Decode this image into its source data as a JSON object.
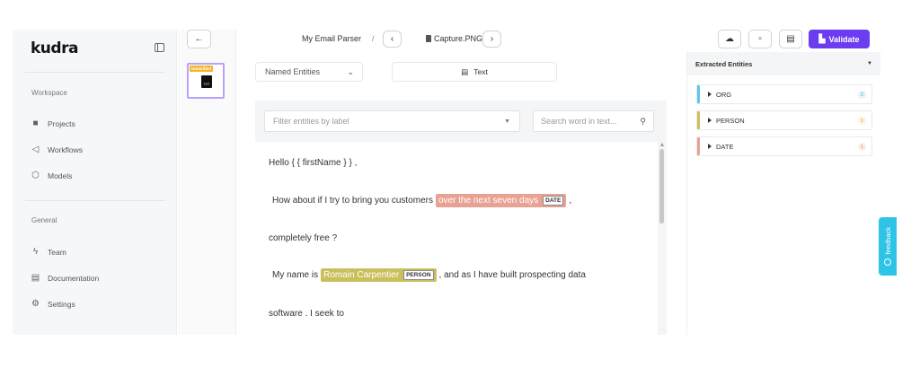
{
  "sidebar": {
    "logo": "kudra",
    "workspace_label": "Workspace",
    "workspace_items": [
      {
        "label": "Projects",
        "icon": "folder-icon"
      },
      {
        "label": "Workflows",
        "icon": "send-icon"
      },
      {
        "label": "Models",
        "icon": "cube-icon"
      }
    ],
    "general_label": "General",
    "general_items": [
      {
        "label": "Team",
        "icon": "bolt-icon"
      },
      {
        "label": "Documentation",
        "icon": "document-icon"
      },
      {
        "label": "Settings",
        "icon": "gear-icon"
      }
    ]
  },
  "thumbnail": {
    "badge": "Unverified",
    "file_type": "TXT"
  },
  "topbar": {
    "back": "←",
    "project": "My Email Parser",
    "separator": "/",
    "prev": "‹",
    "file_name": "Capture.PNG",
    "next": "›",
    "validate_label": "Validate"
  },
  "main": {
    "view_select": "Named Entities",
    "text_tab": "Text",
    "filter_placeholder": "Filter entities by label",
    "search_placeholder": "Search word in text..."
  },
  "document": {
    "line1": "Hello { { firstName } } ,",
    "line2_pre": "How about if I try to bring you customers",
    "line2_entity": "over the next seven days",
    "line2_entity_label": "DATE",
    "line2_post": ",",
    "line3": "completely free ?",
    "line4_pre": "My name is",
    "line4_entity": "Romain Carpentier",
    "line4_entity_label": "PERSON",
    "line4_post": ", and as I have built prospecting data",
    "line5": "software . I seek to"
  },
  "extracted": {
    "title": "Extracted Entities",
    "items": [
      {
        "label": "ORG",
        "count": "2",
        "accent": "#5fc6e8",
        "badge_bg": "#e1f3fb",
        "badge_fg": "#3fa9d4"
      },
      {
        "label": "PERSON",
        "count": "1",
        "accent": "#c9bf5c",
        "badge_bg": "#fbf4dc",
        "badge_fg": "#c9a63a"
      },
      {
        "label": "DATE",
        "count": "1",
        "accent": "#e8a293",
        "badge_bg": "#fdeae5",
        "badge_fg": "#d98874"
      }
    ]
  },
  "feedback": {
    "label": "feedback"
  },
  "colors": {
    "accent": "#6c3cf0",
    "date": "#e8a293",
    "person": "#c9bf5c",
    "feedback": "#2ec4e8"
  }
}
